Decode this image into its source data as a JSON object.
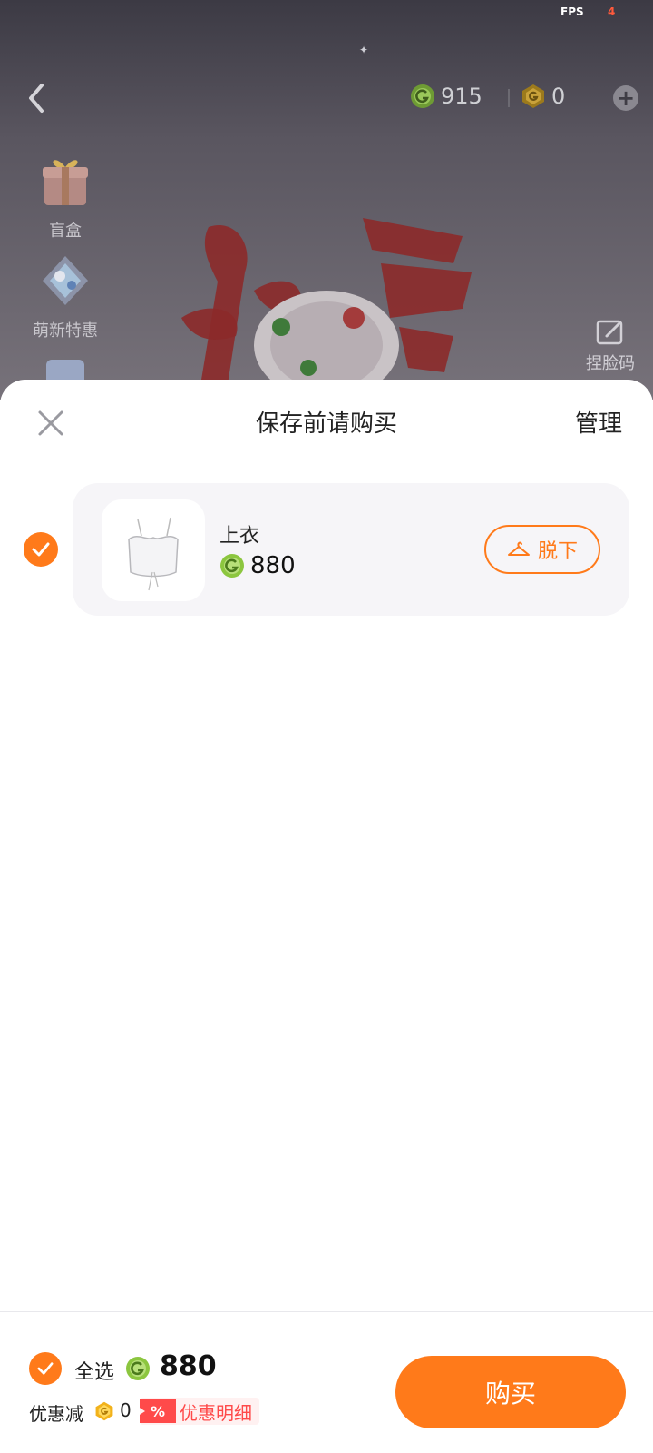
{
  "status": {
    "fps_label": "FPS",
    "fps_value": "4"
  },
  "topbar": {
    "green_coins": "915",
    "gold_coins": "0"
  },
  "sidebar": {
    "items": [
      {
        "label": "盲盒"
      },
      {
        "label": "萌新特惠"
      }
    ]
  },
  "scene": {
    "face_button_label": "捏脸码"
  },
  "sheet": {
    "title": "保存前请购买",
    "manage_label": "管理",
    "items": [
      {
        "name": "上衣",
        "price": "880",
        "takeoff_label": "脱下",
        "selected": true
      }
    ]
  },
  "footer": {
    "select_all_label": "全选",
    "total": "880",
    "discount_label": "优惠减",
    "discount_value": "0",
    "discount_tag": "%",
    "detail_label": "优惠明细",
    "buy_label": "购买"
  },
  "colors": {
    "accent": "#ff7a1a",
    "green_coin": "#8cc63f",
    "gold_coin": "#f2b21b",
    "sale_red": "#ff4a4a"
  }
}
